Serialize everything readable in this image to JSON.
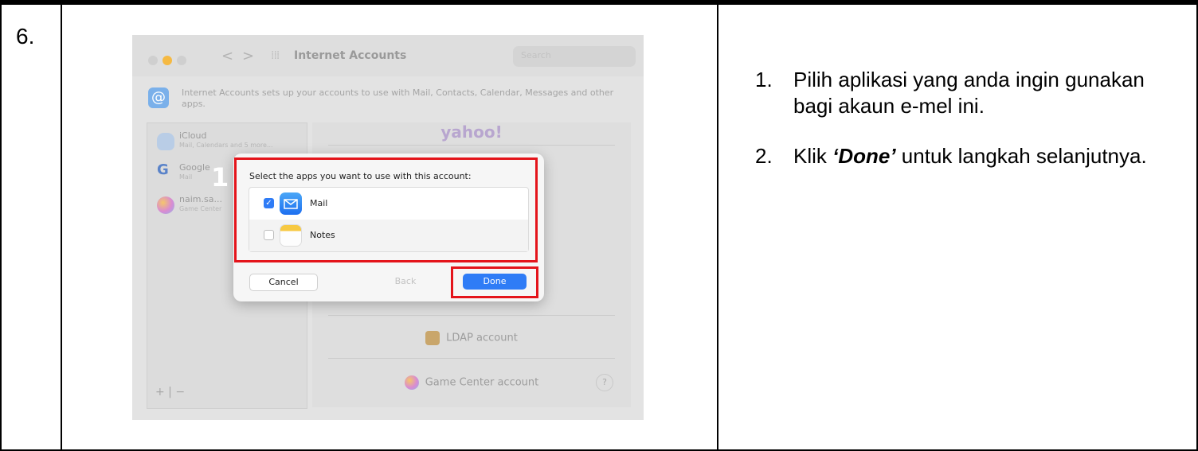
{
  "step_number": "6.",
  "screenshot": {
    "window_title": "Internet Accounts",
    "search_placeholder": "Search",
    "nav_back": "<",
    "nav_forward": ">",
    "description": "Internet Accounts sets up your accounts to use with Mail, Contacts, Calendar, Messages and other apps.",
    "accounts": [
      {
        "name": "iCloud",
        "sub": "Mail, Calendars and 5 more..."
      },
      {
        "name": "Google",
        "sub": "Mail"
      },
      {
        "name": "naim.sa...",
        "sub": "Game Center"
      }
    ],
    "add_remove": "+ | −",
    "providers": {
      "yahoo": "yahoo!",
      "ldap": "LDAP account",
      "game_center": "Game Center account",
      "help": "?"
    },
    "dialog": {
      "prompt": "Select the apps you want to use with this account:",
      "apps": [
        {
          "name": "Mail",
          "checked": true
        },
        {
          "name": "Notes",
          "checked": false
        }
      ],
      "cancel": "Cancel",
      "back": "Back",
      "done": "Done"
    },
    "callout_number": "1"
  },
  "instructions": [
    {
      "num": "1.",
      "text": "Pilih aplikasi yang anda ingin gunakan bagi akaun e-mel ini."
    },
    {
      "num": "2.",
      "pre": "Klik ",
      "bold": "‘Done’",
      "post": " untuk langkah selanjutnya."
    }
  ],
  "colors": {
    "highlight": "#e4141b",
    "accent": "#2f7cf6"
  }
}
